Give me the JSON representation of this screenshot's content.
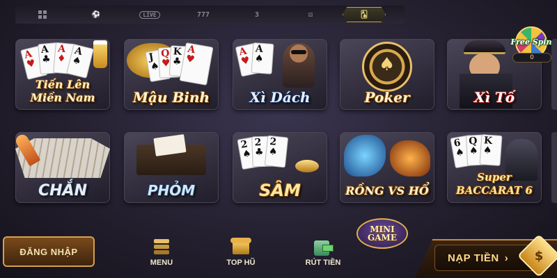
{
  "top_nav": {
    "categories": [
      {
        "icon": "grid-icon",
        "text": ""
      },
      {
        "icon": "soccer-ball-icon",
        "text": ""
      },
      {
        "icon": "live-badge-icon",
        "text": "LIVE"
      },
      {
        "icon": "slot-777-icon",
        "text": "777"
      },
      {
        "icon": "lottery-ball-icon",
        "text": "3"
      },
      {
        "icon": "dice-icon",
        "text": ""
      },
      {
        "icon": "cards-icon",
        "text": ""
      }
    ],
    "active_index": 6
  },
  "games": [
    {
      "id": "tien-len",
      "title_line1": "Tiến Lên",
      "title_line2": "Miền Nam"
    },
    {
      "id": "mau-binh",
      "title_line1": "Mậu Binh",
      "title_line2": ""
    },
    {
      "id": "xi-dach",
      "title_line1": "Xì Dách",
      "title_line2": ""
    },
    {
      "id": "poker",
      "title_line1": "Poker",
      "title_line2": ""
    },
    {
      "id": "xi-to",
      "title_line1": "Xì Tố",
      "title_line2": ""
    },
    {
      "id": "chan",
      "title_line1": "CHẮN",
      "title_line2": ""
    },
    {
      "id": "phom",
      "title_line1": "PHỎM",
      "title_line2": ""
    },
    {
      "id": "sam",
      "title_line1": "SÂM",
      "title_line2": ""
    },
    {
      "id": "rong-ho",
      "title_line1": "RỒNG",
      "title_line2": "VS HỔ"
    },
    {
      "id": "super-baccarat",
      "title_line1": "Super",
      "title_line2": "BACCARAT 6"
    }
  ],
  "free_spin": {
    "label": "Free Spin",
    "count": "0"
  },
  "bottom": {
    "login_label": "ĐĂNG NHẬP",
    "menu_label": "MENU",
    "top_hu_label": "TOP HŨ",
    "withdraw_label": "RÚT TIỀN",
    "mini_game_line1": "MINI",
    "mini_game_line2": "GAME",
    "deposit_label": "NẠP TIỀN",
    "deposit_arrow": "›",
    "dollar_symbol": "$"
  },
  "colors": {
    "accent_gold": "#d8a04a",
    "background": "#24202f"
  }
}
